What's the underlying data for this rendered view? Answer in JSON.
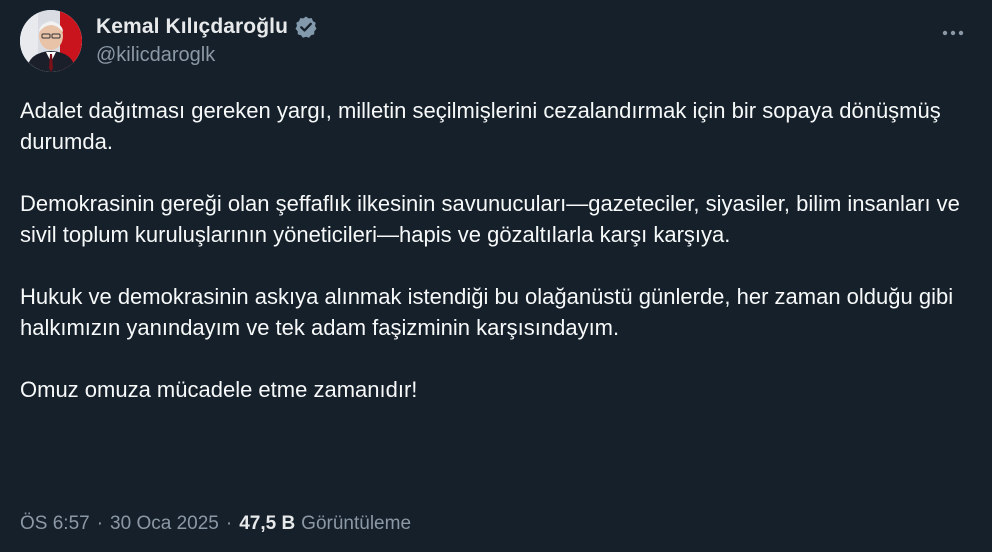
{
  "author": {
    "display_name": "Kemal Kılıçdaroğlu",
    "handle": "@kilicdaroglk",
    "verified_icon": "verified-badge-icon",
    "avatar_icon": "profile-avatar"
  },
  "tweet": {
    "paragraphs": [
      "Adalet dağıtması gereken yargı, milletin seçilmişlerini cezalandırmak için bir sopaya dönüşmüş durumda.",
      "Demokrasinin gereği olan şeffaflık ilkesinin savunucuları—gazeteciler, siyasiler, bilim insanları ve sivil toplum kuruluşlarının yöneticileri—hapis ve gözaltılarla karşı karşıya.",
      "Hukuk ve demokrasinin askıya alınmak istendiği bu olağanüstü günlerde, her zaman olduğu gibi halkımızın yanındayım ve tek adam faşizminin karşısındayım.",
      "Omuz omuza mücadele etme zamanıdır!"
    ]
  },
  "meta": {
    "time": "ÖS 6:57",
    "separator": "·",
    "date": "30 Oca 2025",
    "views_count": "47,5 B",
    "views_label": "Görüntüleme"
  },
  "colors": {
    "background": "#15202b",
    "text": "#f7f9f9",
    "secondary_text": "#8b98a5",
    "verified_fill": "#829aab"
  },
  "more_icon": "more-horizontal-icon"
}
